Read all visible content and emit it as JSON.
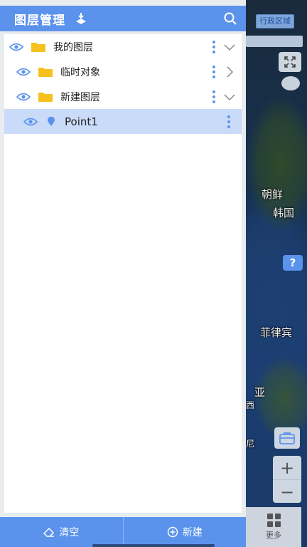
{
  "panel": {
    "title": "图层管理",
    "search_icon": "search-icon",
    "layers": [
      {
        "label": "我的图层",
        "expanded": true
      },
      {
        "label": "临时对象",
        "expanded": false
      },
      {
        "label": "新建图层",
        "expanded": true
      },
      {
        "label": "Point1",
        "selected": true
      }
    ],
    "footer": {
      "clear_label": "清空",
      "new_label": "新建"
    }
  },
  "map": {
    "top_chip": "行政区域",
    "labels": [
      "朝鲜",
      "韩国",
      "菲律宾",
      "亚",
      "西",
      "尼"
    ],
    "more_label": "更多",
    "zoom_in": "+",
    "zoom_out": "−"
  },
  "colors": {
    "accent": "#5b93ec",
    "selected_row": "#c9dbf9",
    "folder": "#f6c01e"
  }
}
